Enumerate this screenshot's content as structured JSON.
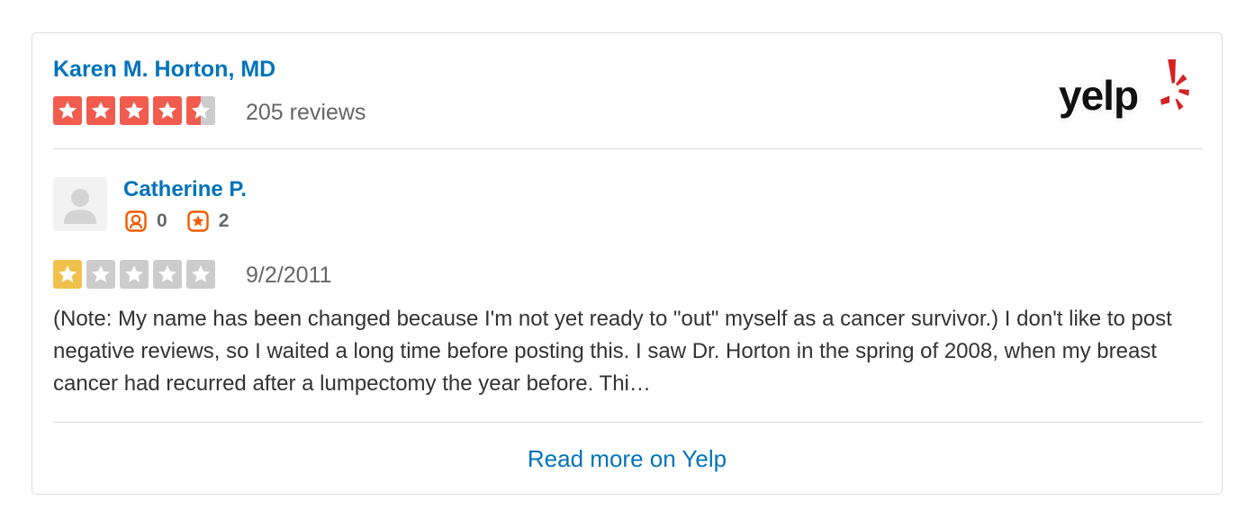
{
  "business": {
    "name": "Karen M. Horton, MD",
    "rating": 4.5,
    "rating_color": "#f15c4f",
    "review_count_text": "205 reviews"
  },
  "logo": {
    "text": "yelp",
    "icon": "yelp-burst-icon",
    "color": "#d32323"
  },
  "review": {
    "user_name": "Catherine P.",
    "friends_count": "0",
    "reviews_count": "2",
    "friends_icon": "friends-icon",
    "reviews_icon": "review-star-icon",
    "stat_color": "#f15c00",
    "rating": 1,
    "rating_color": "#f0c14b",
    "date": "9/2/2011",
    "text": "(Note: My name has been changed because I'm not yet ready to \"out\" myself as a cancer survivor.) I don't like to post negative reviews, so I waited a long time before posting this. I saw Dr. Horton in the spring of 2008, when my breast cancer had recurred after a lumpectomy the year before. Thi…"
  },
  "footer": {
    "read_more": "Read more on Yelp"
  },
  "colors": {
    "link": "#0073bb",
    "empty_star": "#cccccc",
    "border": "#dcdcdc"
  }
}
